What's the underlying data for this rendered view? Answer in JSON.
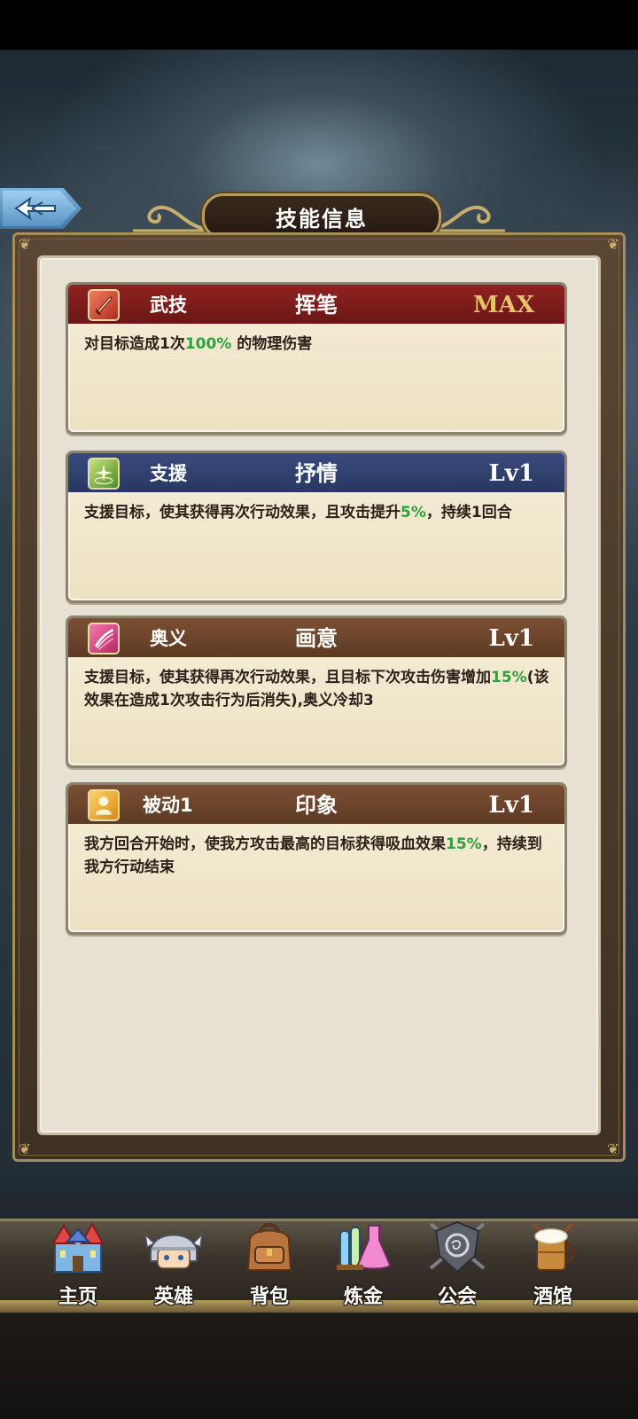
{
  "header": {
    "title": "技能信息"
  },
  "skills": [
    {
      "type": "武技",
      "name": "挥笔",
      "level": "MAX",
      "desc": [
        {
          "text": "对目标造成1次",
          "hl": false
        },
        {
          "text": "100%",
          "hl": true
        },
        {
          "text": " 的物理伤害",
          "hl": false
        }
      ],
      "icon": "sword-skill-icon"
    },
    {
      "type": "支援",
      "name": "抒情",
      "level": "Lv1",
      "desc": [
        {
          "text": "支援目标，使其获得再次行动效果，且攻击提升",
          "hl": false
        },
        {
          "text": "5%",
          "hl": true
        },
        {
          "text": "，持续1回合",
          "hl": false
        }
      ],
      "icon": "sparkle-skill-icon"
    },
    {
      "type": "奥义",
      "name": "画意",
      "level": "Lv1",
      "desc": [
        {
          "text": "支援目标，使其获得再次行动效果，且目标下次攻击伤害增加",
          "hl": false
        },
        {
          "text": "15%",
          "hl": true
        },
        {
          "text": "(该效果在造成1次攻击行为后消失),奥义冷却3",
          "hl": false
        }
      ],
      "icon": "slash-skill-icon"
    },
    {
      "type": "被动1",
      "name": "印象",
      "level": "Lv1",
      "desc": [
        {
          "text": "我方回合开始时，使我方攻击最高的目标获得吸血效果",
          "hl": false
        },
        {
          "text": "15%",
          "hl": true
        },
        {
          "text": "，持续到我方行动结束",
          "hl": false
        }
      ],
      "icon": "person-skill-icon"
    }
  ],
  "nav": [
    {
      "label": "主页",
      "icon": "castle-icon"
    },
    {
      "label": "英雄",
      "icon": "knight-helmet-icon"
    },
    {
      "label": "背包",
      "icon": "backpack-icon"
    },
    {
      "label": "炼金",
      "icon": "potion-flask-icon"
    },
    {
      "label": "公会",
      "icon": "guild-shield-icon"
    },
    {
      "label": "酒馆",
      "icon": "beer-mug-icon"
    }
  ],
  "colors": {
    "highlight": "#2ea13a",
    "max_level": "#e5c46a",
    "head_red": "#8e2320",
    "head_blue": "#384a7c",
    "head_brown": "#7b5033"
  }
}
